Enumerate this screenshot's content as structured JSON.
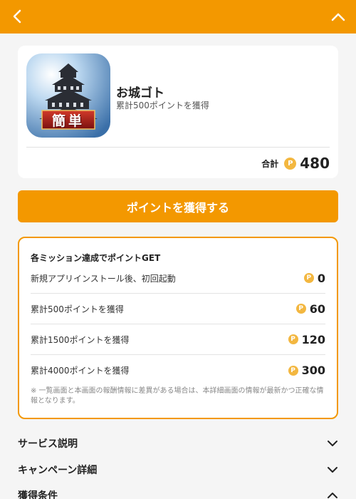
{
  "header": {
    "back_icon": "chevron-left-icon",
    "collapse_icon": "chevron-up-icon",
    "background_color": "#f39800"
  },
  "app": {
    "icon": "castle-app-icon",
    "icon_badge_text": "簡単",
    "name": "お城ゴト",
    "subtitle": "累計500ポイントを獲得",
    "total_label": "合計",
    "total_value": "480",
    "coin_symbol": "P"
  },
  "cta": {
    "label": "ポイントを獲得する"
  },
  "missions": {
    "title": "各ミッション達成でポイントGET",
    "items": [
      {
        "label": "新規アプリインストール後、初回起動",
        "reward": "0"
      },
      {
        "label": "累計500ポイントを獲得",
        "reward": "60"
      },
      {
        "label": "累計1500ポイントを獲得",
        "reward": "120"
      },
      {
        "label": "累計4000ポイントを獲得",
        "reward": "300"
      }
    ],
    "note": "※ 一覧画面と本画面の報酬情報に差異がある場合は、本詳細画面の情報が最新かつ正確な情報となります。"
  },
  "accordion": [
    {
      "label": "サービス説明",
      "state": "collapsed"
    },
    {
      "label": "キャンペーン詳細",
      "state": "collapsed"
    },
    {
      "label": "獲得条件",
      "state": "expanded"
    }
  ],
  "colors": {
    "accent": "#f39800",
    "coin": "#f3b740",
    "page_background": "#f5f5f5"
  }
}
